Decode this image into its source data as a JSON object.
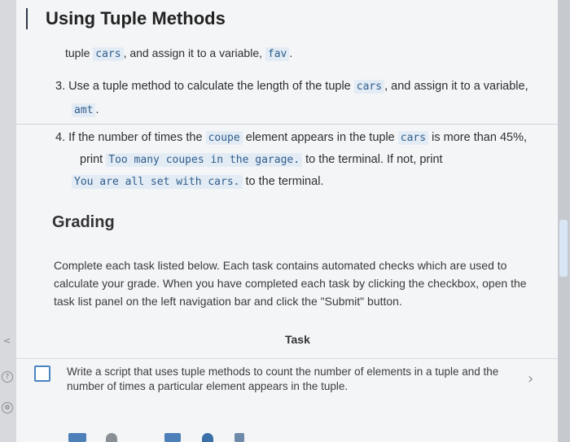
{
  "title": "Using Tuple Methods",
  "intro": {
    "text1": "tuple",
    "code1": "cars",
    "text2": ", and assign it to a variable,",
    "code2": "fav",
    "text3": "."
  },
  "task3": {
    "text1": "3. Use a tuple method to calculate the length of the tuple",
    "code1": "cars",
    "text2": ", and assign it to a variable,",
    "code2": "amt",
    "text3": "."
  },
  "task4": {
    "text1": "4. If the number of times the",
    "code1": "coupe",
    "text2": "element appears in the tuple",
    "code2": "cars",
    "text3": "is more than 45%,",
    "text4": "print",
    "code3": "Too many coupes in the garage.",
    "text5": "to the terminal. If not, print",
    "code4": "You are all set with cars.",
    "text6": "to the terminal."
  },
  "grading": {
    "heading": "Grading",
    "description": "Complete each task listed below. Each task contains automated checks which are used to calculate your grade. When you have completed each task by clicking the checkbox, open the task list panel on the left navigation bar and click the \"Submit\" button.",
    "task_column": "Task",
    "tasks": [
      {
        "text": "Write a script that uses tuple methods to count the number of elements in a tuple and the number of times a particular element appears in the tuple.",
        "checked": false
      }
    ]
  },
  "icons": {
    "help": "help-icon",
    "settings": "settings-icon",
    "chevron": "chevron-right-icon"
  },
  "colors": {
    "code_text": "#2f5d8c",
    "checkbox_border": "#4a84c1"
  }
}
